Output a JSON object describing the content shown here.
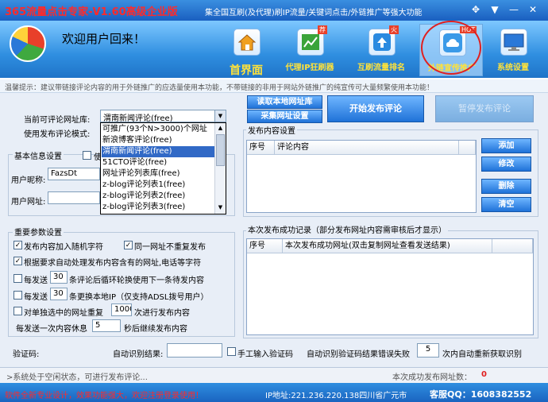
{
  "window": {
    "title": "365流量点击专家-V1.60高级企业版",
    "slogan": "集全国互刷(及代理)刷IP流量/关键词点击/外链推广等强大功能",
    "controls": [
      "✥",
      "▼",
      "—",
      "✕"
    ]
  },
  "header": {
    "welcome": "欢迎用户回来！",
    "nav": [
      {
        "label": "首界面",
        "icon": "house-icon"
      },
      {
        "label": "代理IP狂刷器",
        "icon": "chart-icon",
        "badge": "荐"
      },
      {
        "label": "互刷流量排名",
        "icon": "upload-icon",
        "badge": "火"
      },
      {
        "label": "外链宣传推广",
        "icon": "cloud-icon",
        "badge": "HOT"
      },
      {
        "label": "系统设置",
        "icon": "monitor-icon"
      }
    ]
  },
  "notice": "温馨提示：建议带链接评论内容的用于外链推广的应选量使用本功能，不带链接的非用于网站外链推广的纯宣传可大量频繁使用本功能！",
  "form": {
    "current_site_label": "当前可评论网址库:",
    "current_site_value": "渭南新闻评论(free)",
    "mode_label": "使用发布评论模式:",
    "basic_group_title": "基本信息设置",
    "basic_checkbox_label": "使",
    "nickname_label": "用户昵称:",
    "nickname_value": "FazsDt",
    "url_label": "用户网址:",
    "url_value": ""
  },
  "dropdown": {
    "items": [
      "可推广(93个N>3000)个网址",
      "新浪博客评论(free)",
      "渭南新闻评论(free)",
      "51CTO评论(free)",
      "网址评论列表库(free)",
      "z-blog评论列表1(free)",
      "z-blog评论列表2(free)",
      "z-blog评论列表3(free)"
    ],
    "selected_index": 2
  },
  "buttons": {
    "read_local": "读取本地网址库",
    "collect": "采集网址设置",
    "start": "开始发布评论",
    "stop": "暂停发布评论"
  },
  "content_group": {
    "title": "发布内容设置",
    "col_index": "序号",
    "col_content": "评论内容",
    "add": "添加",
    "edit": "修改",
    "delete": "删除",
    "clear": "清空"
  },
  "params": {
    "title": "重要参数设置",
    "c1": "发布内容加入随机字符",
    "c2": "同一网址不重复发布",
    "c3": "根据要求自动处理发布内容含有的网址,电话等字符",
    "r1_pre": "每发送",
    "r1_val": "30",
    "r1_post": "条评论后循环轮换使用下一条待发内容",
    "r2_pre": "每发送",
    "r2_val": "30",
    "r2_post": "条更换本地IP（仅支持ADSL拨号用户）",
    "r3_pre": "对单独选中的网址重复",
    "r3_val": "1000",
    "r3_post": "次进行发布内容",
    "r4_pre": "每发送一次内容休息",
    "r4_val": "5",
    "r4_post": "秒后继续发布内容"
  },
  "success_group": {
    "title": "本次发布成功记录（部分发布网址内容需审核后才显示）",
    "col_index": "序号",
    "col_url": "本次发布成功网址(双击复制网址查看发送结果)"
  },
  "captcha": {
    "label": "验证码:",
    "auto_label": "自动识别结果:",
    "manual_label": "手工输入验证码",
    "fail_pre": "自动识别验证码结果错误失败",
    "fail_val": "5",
    "fail_post": "次内自动重新获取识别"
  },
  "status": {
    "left": ">系统处于空闲状态，可进行发布评论...",
    "right_label": "本次成功发布网址数：",
    "right_value": "0"
  },
  "footer": {
    "left": "软件全新专业设计，效果功能强大，欢迎注册登录使用！",
    "ip": "IP地址:221.236.220.138四川省广元市",
    "qq": "客服QQ：1608382552"
  },
  "colors": {
    "title_red": "#ff2a2a",
    "accent_blue": "#1f72d8",
    "nav_yellow": "#ffe23a",
    "ring_red": "#e02020"
  }
}
